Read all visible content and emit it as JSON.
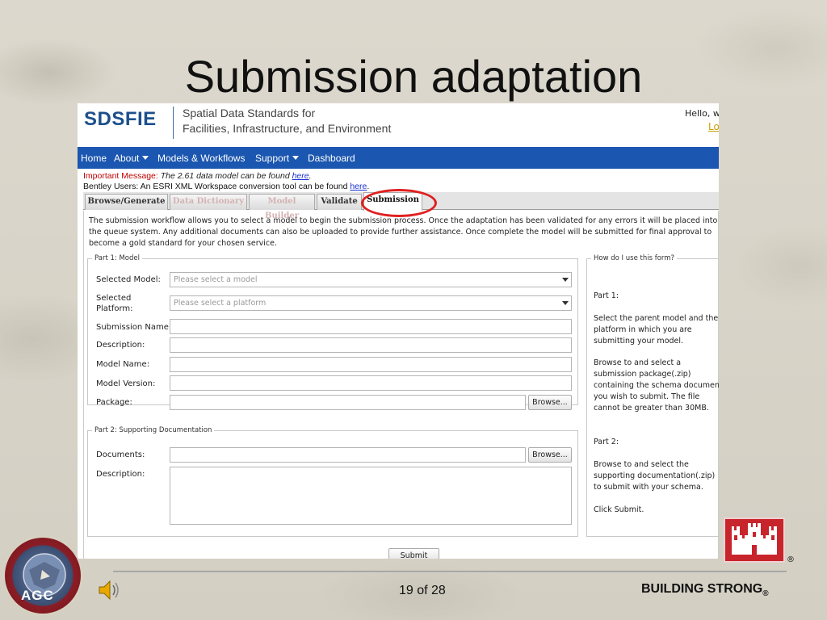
{
  "slide": {
    "title": "Submission adaptation",
    "page": "19 of 28",
    "footer_brand": "BUILDING STRONG",
    "footer_brand_mark": "®",
    "reg_mark": "®",
    "seal_text": "AGC",
    "icons": [
      "speaker-icon",
      "usace-castle-logo",
      "agc-seal"
    ],
    "colors": {
      "accent_red": "#c8242c",
      "nav_blue": "#1b56b0"
    }
  },
  "app": {
    "logo": "SDSFIE",
    "subtitle_line1": "Spatial Data Standards for",
    "subtitle_line2": "Facilities, Infrastructure, and Environment",
    "greeting": "Hello, w",
    "login_link": "Lo"
  },
  "nav": {
    "home": "Home",
    "about": "About",
    "models": "Models & Workflows",
    "support": "Support",
    "dashboard": "Dashboard"
  },
  "messages": {
    "important_label": "Important Message:",
    "important_text": "The 2.61 data model can be found",
    "important_link": "here",
    "bentley_text": "Bentley Users: An ESRI XML Workspace conversion tool can be found",
    "bentley_link": "here"
  },
  "tabs": [
    {
      "label": "Browse/Generate",
      "state": "normal"
    },
    {
      "label": "Data Dictionary",
      "state": "disabled"
    },
    {
      "label": "Model Builder",
      "state": "disabled"
    },
    {
      "label": "Validate",
      "state": "normal"
    },
    {
      "label": "Submission",
      "state": "active"
    }
  ],
  "intro": "The submission workflow allows you to select a model to begin the submission process. Once the adaptation has been validated for any errors it will be placed into the queue system. Any additional documents can also be uploaded to provide further assistance. Once complete the model will be submitted for final approval to become a gold standard for your chosen service.",
  "part1": {
    "legend": "Part 1: Model",
    "selected_model_label": "Selected Model:",
    "selected_model_placeholder": "Please select a model",
    "selected_platform_label_1": "Selected",
    "selected_platform_label_2": "Platform:",
    "selected_platform_placeholder": "Please select a platform",
    "submission_name_label": "Submission Name:",
    "description_label": "Description:",
    "model_name_label": "Model Name:",
    "model_version_label": "Model Version:",
    "package_label": "Package:",
    "browse_label": "Browse..."
  },
  "part2": {
    "legend": "Part 2: Supporting Documentation",
    "documents_label": "Documents:",
    "description_label": "Description:",
    "browse_label": "Browse..."
  },
  "help": {
    "legend": "How do I use this form?",
    "part1_heading": "Part 1:",
    "part1_p1": "Select the parent model and the platform in which you are submitting your model.",
    "part1_p2": "Browse to and select a submission package(.zip) containing the schema document you wish to submit. The file cannot be greater than 30MB.",
    "part2_heading": "Part 2:",
    "part2_p1": "Browse to and select the supporting documentation(.zip) to submit with your schema.",
    "click_submit": "Click Submit."
  },
  "submit_label": "Submit"
}
